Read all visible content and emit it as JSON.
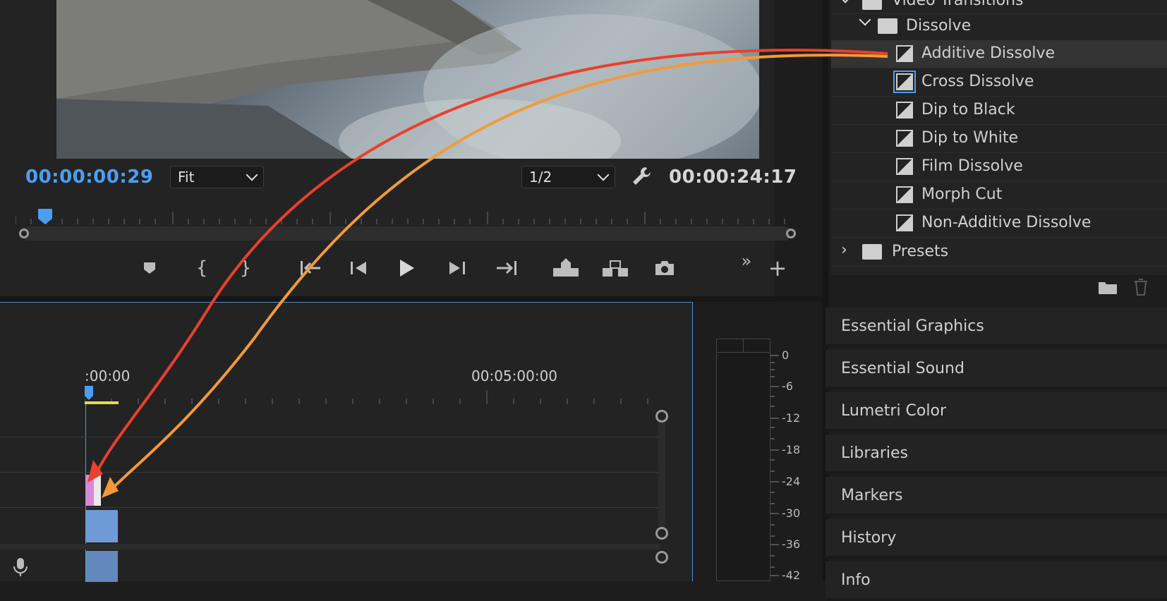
{
  "monitor": {
    "current_timecode": "00:00:00:29",
    "duration_timecode": "00:00:24:17",
    "zoom": "Fit",
    "resolution": "1/2"
  },
  "timeline": {
    "time_start": ":00:00",
    "time_mark": "00:05:00:00"
  },
  "meter": {
    "db_labels": [
      "0",
      "-6",
      "-12",
      "-18",
      "-24",
      "-30",
      "-36",
      "-42"
    ]
  },
  "effects": {
    "parent_folder": "Video Transitions",
    "folder": "Dissolve",
    "items": [
      {
        "label": "Additive Dissolve"
      },
      {
        "label": "Cross Dissolve"
      },
      {
        "label": "Dip to Black"
      },
      {
        "label": "Dip to White"
      },
      {
        "label": "Film Dissolve"
      },
      {
        "label": "Morph Cut"
      },
      {
        "label": "Non-Additive Dissolve"
      }
    ],
    "presets": "Presets"
  },
  "panels": [
    "Essential Graphics",
    "Essential Sound",
    "Lumetri Color",
    "Libraries",
    "Markers",
    "History",
    "Info"
  ],
  "colors": {
    "accent": "#4a9ff5",
    "arrow_red": "#e8412c",
    "arrow_orange": "#f29a38",
    "clip_blue": "#6f9ad8",
    "clip_pink": "#d689d6"
  }
}
